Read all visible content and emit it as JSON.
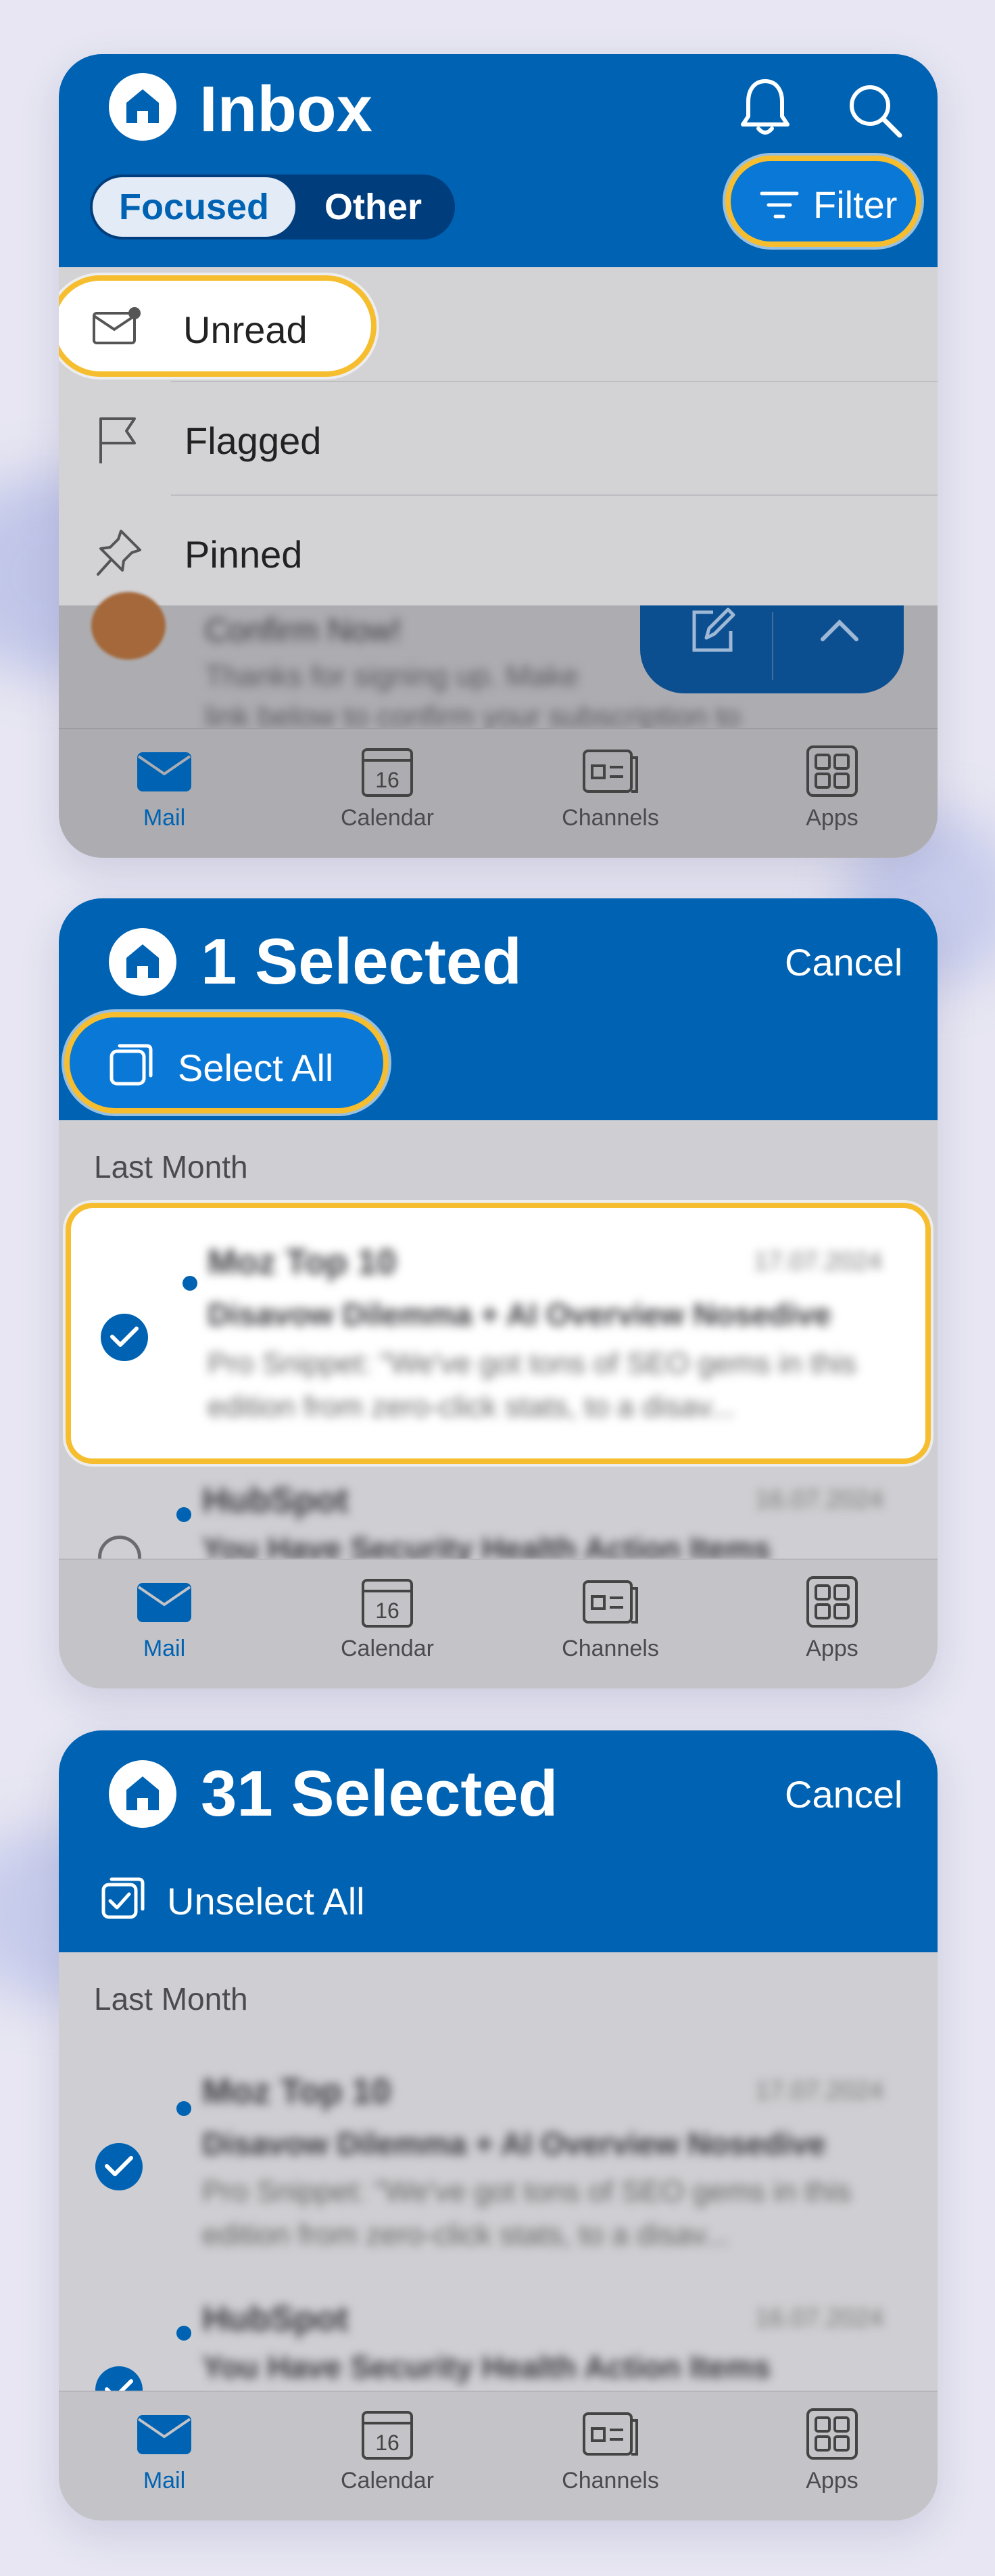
{
  "panel1": {
    "title": "Inbox",
    "tabs": [
      "Focused",
      "Other"
    ],
    "filter_label": "Filter",
    "filter_menu": [
      "Unread",
      "Flagged",
      "Pinned"
    ],
    "blurred_email": {
      "sender": "Confirm Now!",
      "preview1": "Thanks for signing up. Make",
      "preview2": "link below to confirm your subscription to"
    }
  },
  "panel2": {
    "title": "1 Selected",
    "cancel": "Cancel",
    "select_all": "Select All",
    "section": "Last Month",
    "emails": [
      {
        "sender": "Moz Top 10",
        "date": "17.07.2024",
        "subject": "Disavow Dilemma + AI Overview Nosedive",
        "preview": "Pro Snippet: \"We've got tons of SEO gems in this edition from zero-click stats, to a disav...",
        "checked": true
      },
      {
        "sender": "HubSpot",
        "date": "16.07.2024",
        "subject": "You Have Security Health Action Items",
        "checked": false
      }
    ]
  },
  "panel3": {
    "title": "31 Selected",
    "cancel": "Cancel",
    "unselect_all": "Unselect All",
    "section": "Last Month",
    "emails": [
      {
        "sender": "Moz Top 10",
        "date": "17.07.2024",
        "subject": "Disavow Dilemma + AI Overview Nosedive",
        "preview": "Pro Snippet: \"We've got tons of SEO gems in this edition from zero-click stats, to a disav...",
        "checked": true
      },
      {
        "sender": "HubSpot",
        "date": "16.07.2024",
        "subject": "You Have Security Health Action Items",
        "checked": true
      }
    ]
  },
  "nav": [
    "Mail",
    "Calendar",
    "Channels",
    "Apps"
  ],
  "calendar_day": "16",
  "colors": {
    "brand": "#0062b2",
    "highlight": "#f6be2e",
    "accent_button": "#0a78d6"
  }
}
